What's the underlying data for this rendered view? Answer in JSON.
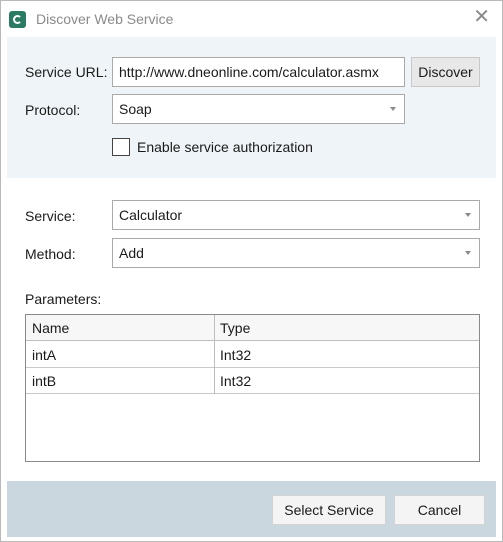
{
  "window": {
    "title": "Discover Web Service",
    "icon": "app-logo-icon",
    "close_icon": "close-icon"
  },
  "discovery": {
    "service_url_label": "Service URL:",
    "service_url_value": "http://www.dneonline.com/calculator.asmx",
    "discover_button": "Discover",
    "protocol_label": "Protocol:",
    "protocol_value": "Soap",
    "auth_checkbox_label": "Enable service authorization",
    "auth_checked": false
  },
  "selection": {
    "service_label": "Service:",
    "service_value": "Calculator",
    "method_label": "Method:",
    "method_value": "Add"
  },
  "parameters": {
    "label": "Parameters:",
    "columns": [
      "Name",
      "Type"
    ],
    "rows": [
      {
        "name": "intA",
        "type": "Int32"
      },
      {
        "name": "intB",
        "type": "Int32"
      }
    ]
  },
  "footer": {
    "select_button": "Select Service",
    "cancel_button": "Cancel"
  },
  "colors": {
    "top_panel_bg": "#eef4f7",
    "footer_bg": "#cbd7df",
    "icon_green": "#2b7a64"
  }
}
